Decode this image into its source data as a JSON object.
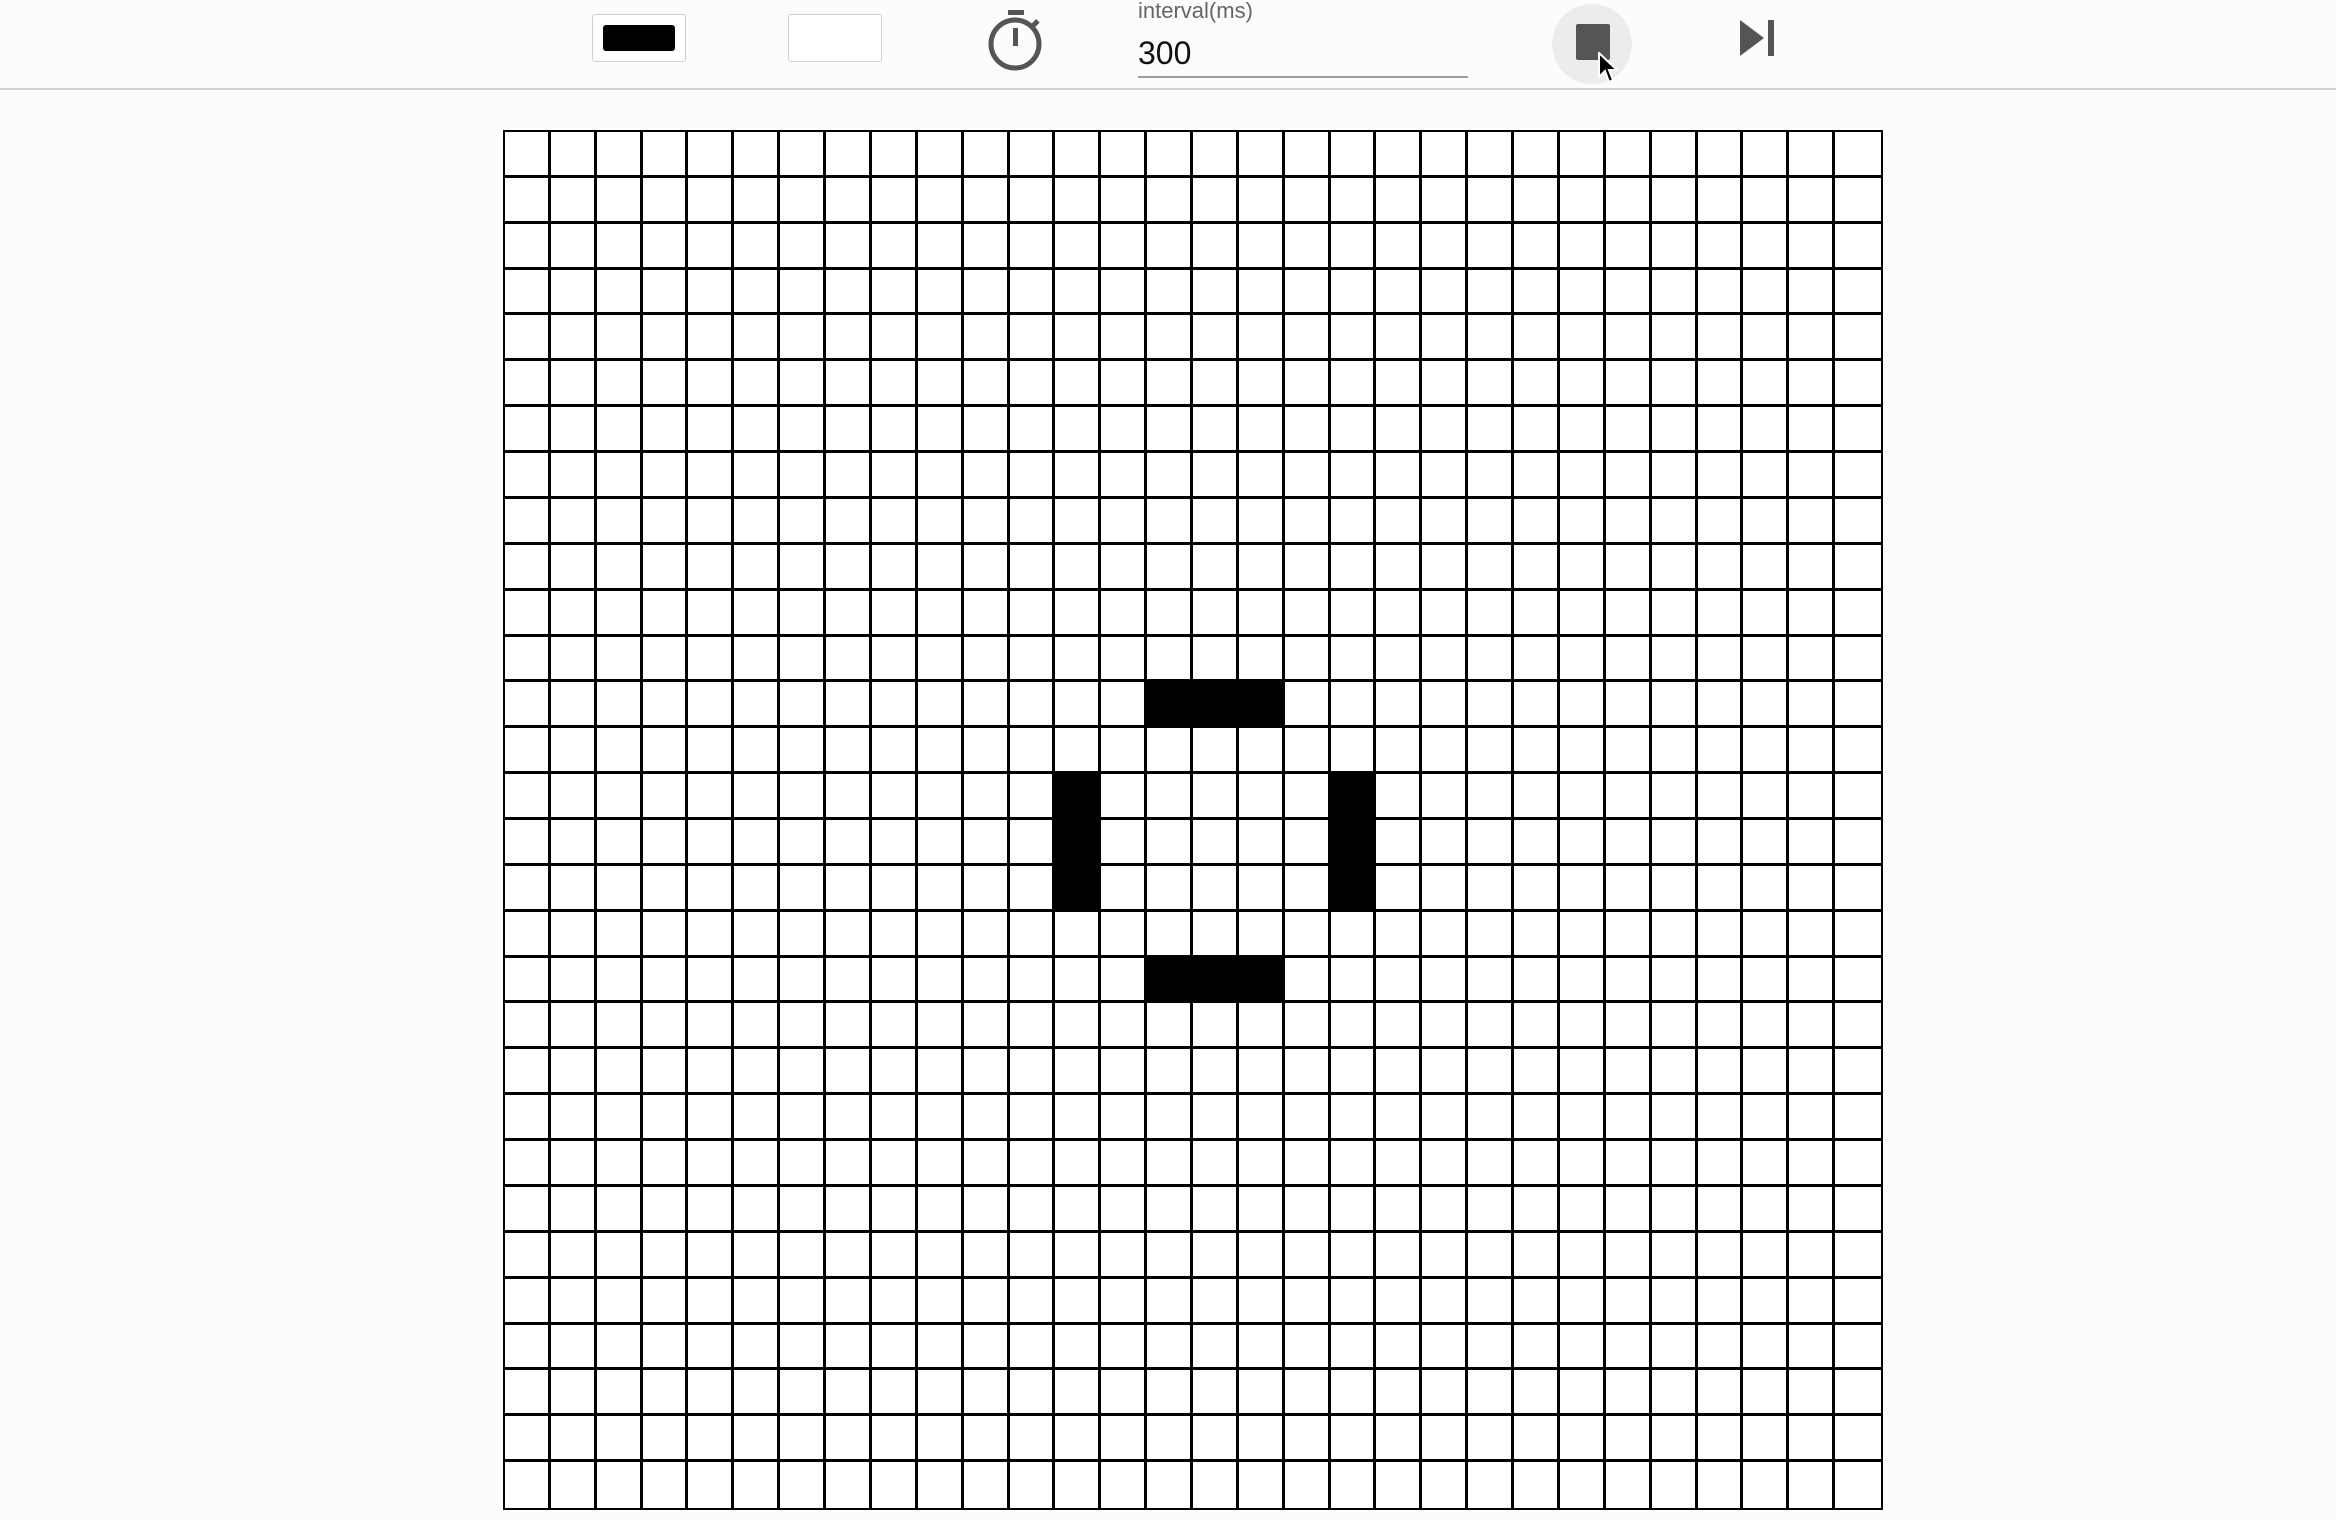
{
  "toolbar": {
    "alive_color": "#000000",
    "dead_color": "#ffffff",
    "timer_icon": "stopwatch-icon",
    "interval_label": "interval(ms)",
    "interval_value": "300",
    "stop_icon": "stop-icon",
    "next_icon": "skip-next-icon"
  },
  "board": {
    "rows": 30,
    "cols": 30,
    "alive_color": "#000000",
    "dead_color": "#ffffff",
    "alive_cells": [
      [
        12,
        14
      ],
      [
        12,
        15
      ],
      [
        12,
        16
      ],
      [
        14,
        12
      ],
      [
        15,
        12
      ],
      [
        16,
        12
      ],
      [
        14,
        18
      ],
      [
        15,
        18
      ],
      [
        16,
        18
      ],
      [
        18,
        14
      ],
      [
        18,
        15
      ],
      [
        18,
        16
      ]
    ]
  }
}
